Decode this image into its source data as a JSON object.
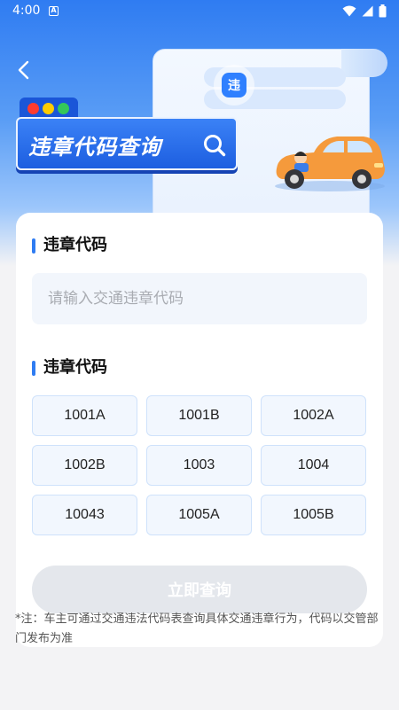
{
  "status_bar": {
    "time": "4:00",
    "notification_glyph": "A",
    "icons": [
      "wifi-icon",
      "signal-icon",
      "battery-icon"
    ]
  },
  "header": {
    "back_icon": "chevron-left-icon",
    "banner_title": "违章代码查询",
    "badge_char": "违",
    "banner_icon": "search-icon"
  },
  "form": {
    "input_section_title": "违章代码",
    "input_placeholder": "请输入交通违章代码",
    "input_value": "",
    "codes_section_title": "违章代码",
    "codes": [
      "1001A",
      "1001B",
      "1002A",
      "1002B",
      "1003",
      "1004",
      "10043",
      "1005A",
      "1005B"
    ],
    "submit_label": "立即查询"
  },
  "note": "*注：车主可通过交通违法代码表查询具体交通违章行为，代码以交管部门发布为准",
  "colors": {
    "primary": "#2f7cf2",
    "banner_dark": "#1d5ee0",
    "submit_disabled": "#e4e7ec",
    "code_bg": "#f2f7fe",
    "code_border": "#cfe2fb",
    "car_orange": "#f59a3c"
  }
}
